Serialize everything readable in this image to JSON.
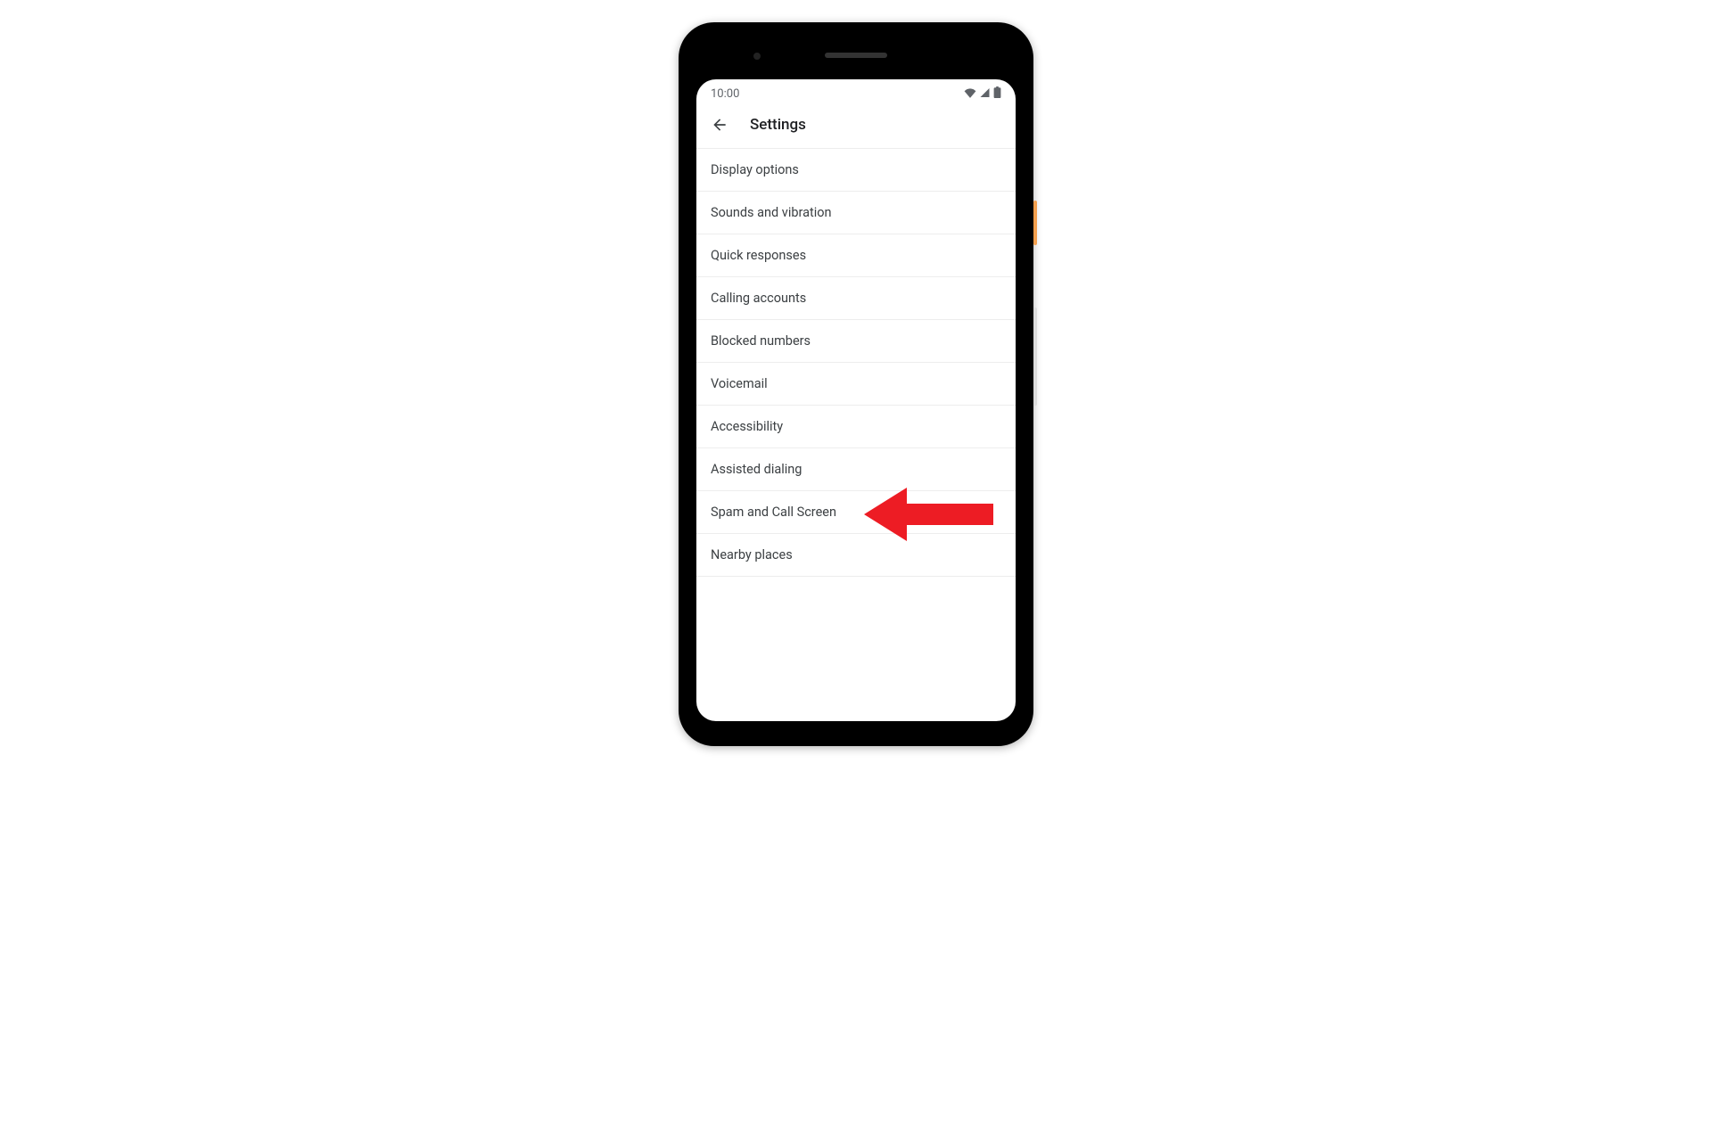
{
  "status_bar": {
    "time": "10:00"
  },
  "header": {
    "title": "Settings"
  },
  "settings": {
    "items": [
      {
        "label": "Display options"
      },
      {
        "label": "Sounds and vibration"
      },
      {
        "label": "Quick responses"
      },
      {
        "label": "Calling accounts"
      },
      {
        "label": "Blocked numbers"
      },
      {
        "label": "Voicemail"
      },
      {
        "label": "Accessibility"
      },
      {
        "label": "Assisted dialing"
      },
      {
        "label": "Spam and Call Screen"
      },
      {
        "label": "Nearby places"
      }
    ]
  },
  "annotation": {
    "arrow_color": "#ED1C24",
    "target_item_index": 8
  }
}
